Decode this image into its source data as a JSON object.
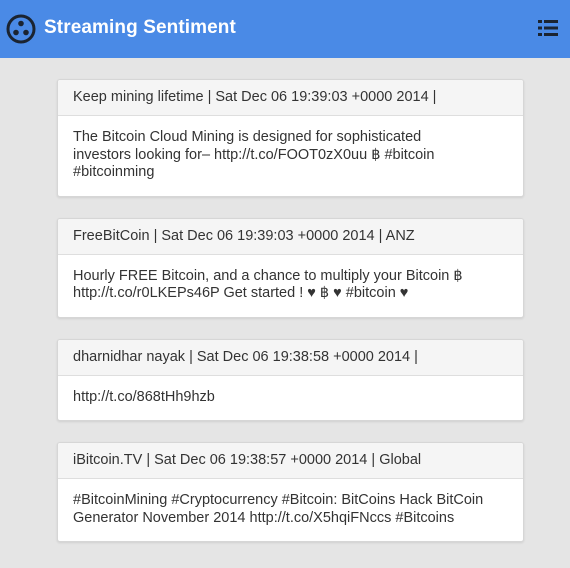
{
  "app": {
    "title": "Streaming Sentiment",
    "logo_icon": "triple-dot-circle-icon",
    "menu_icon": "list-menu-icon"
  },
  "colors": {
    "appbar": "#4a8ae6",
    "background": "#e5e5e5",
    "card_header": "#f5f5f5"
  },
  "tweets": [
    {
      "header": "Keep mining lifetime | Sat Dec 06 19:39:03 +0000 2014 |",
      "body": "The Bitcoin Cloud Mining is designed for sophisticated\ninvestors looking for– http://t.co/FOOT0zX0uu ฿ #bitcoin\n#bitcoinming"
    },
    {
      "header": "FreeBitCoin | Sat Dec 06 19:39:03 +0000 2014 | ANZ",
      "body": "Hourly FREE Bitcoin, and a chance to multiply your Bitcoin ฿\nhttp://t.co/r0LKEPs46P Get started ! ♥ ฿ ♥ #bitcoin ♥"
    },
    {
      "header": "dharnidhar nayak | Sat Dec 06 19:38:58 +0000 2014 |",
      "body": "http://t.co/868tHh9hzb"
    },
    {
      "header": "iBitcoin.TV | Sat Dec 06 19:38:57 +0000 2014 | Global",
      "body": "#BitcoinMining #Cryptocurrency #Bitcoin: BitCoins Hack BitCoin\nGenerator November 2014 http://t.co/X5hqiFNccs #Bitcoins"
    }
  ]
}
